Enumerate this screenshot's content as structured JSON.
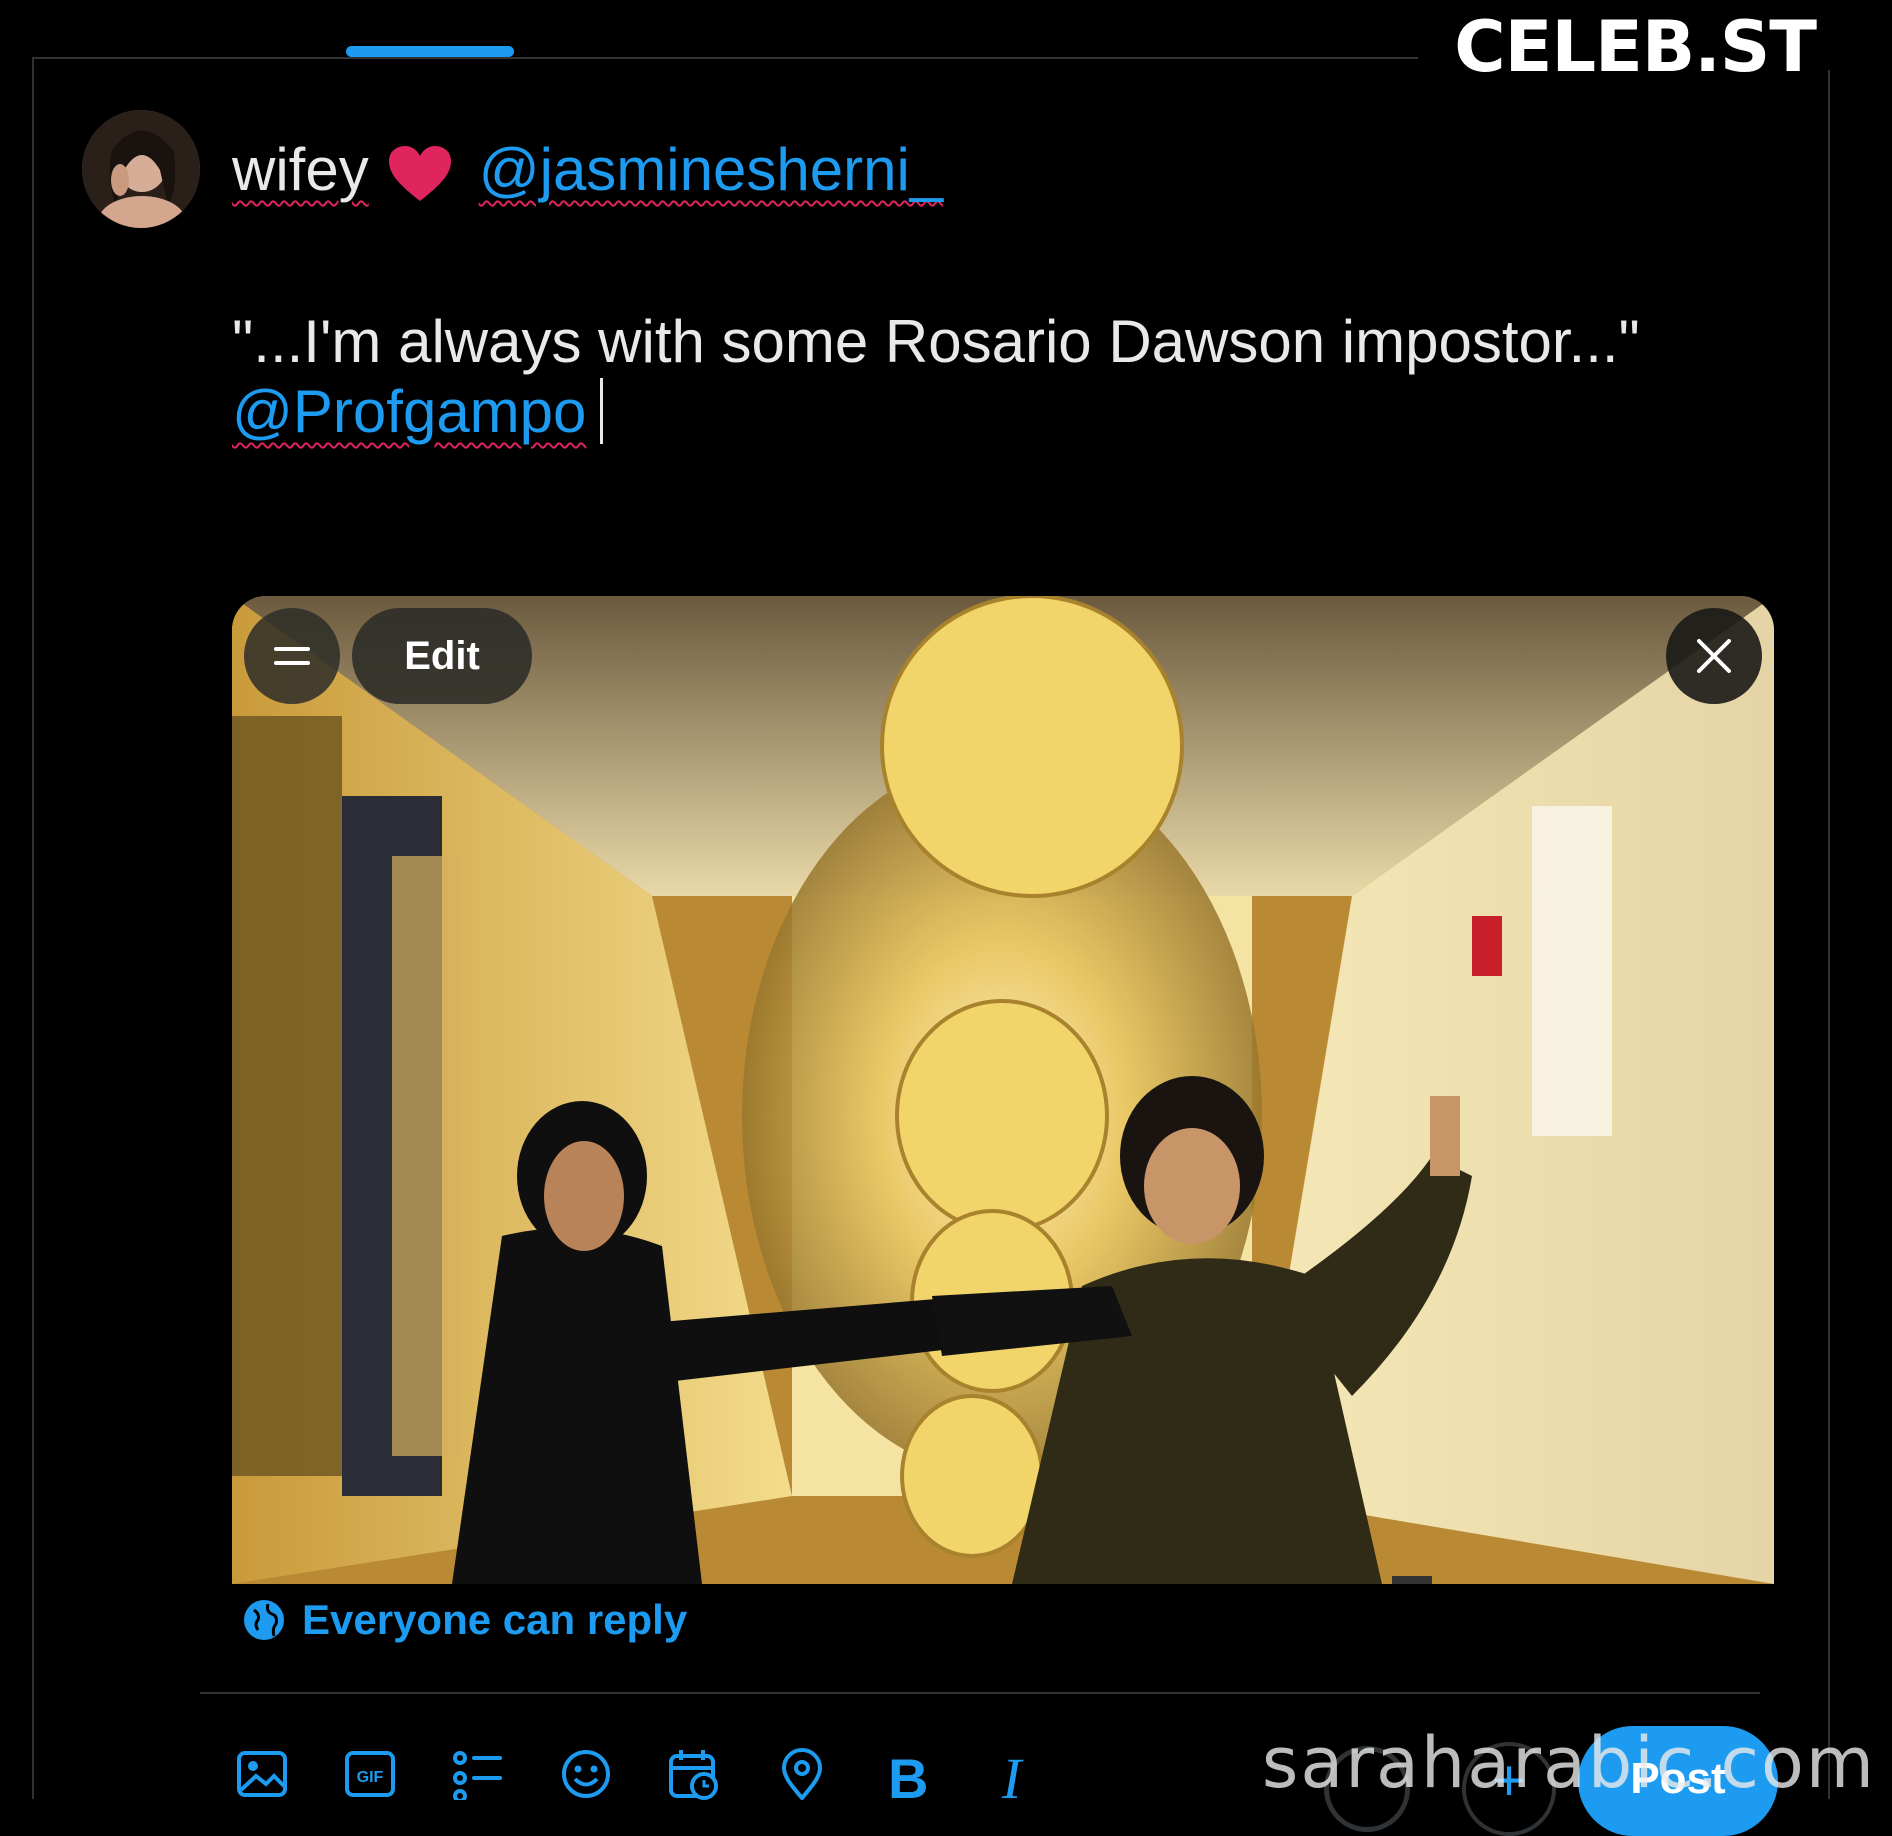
{
  "watermark_top": "CELEB.ST",
  "composer": {
    "display_name": "wifey",
    "heart_icon": "red-heart-emoji",
    "mention_1": "@jasminesherni_",
    "quote": "\"...I'm always with some Rosario Dawson impostor...\"",
    "mention_2": "@Profgampo"
  },
  "media": {
    "edit_label": "Edit",
    "menu_icon": "menu-icon",
    "close_icon": "close-icon"
  },
  "reply_setting": {
    "label": "Everyone can reply",
    "icon": "globe-icon"
  },
  "toolbar": {
    "icons": [
      "image-icon",
      "gif-icon",
      "poll-icon",
      "emoji-icon",
      "schedule-icon",
      "location-icon",
      "bold-icon",
      "italic-icon"
    ],
    "gif_text": "GIF",
    "bold_text": "B",
    "italic_text": "I",
    "add_text": "+",
    "post_label": "Post"
  },
  "watermark_bottom": "saraharabic.com",
  "colors": {
    "accent": "#1d9bf0",
    "background": "#000000",
    "text": "#e7e9ea",
    "heart": "#e0245e"
  }
}
